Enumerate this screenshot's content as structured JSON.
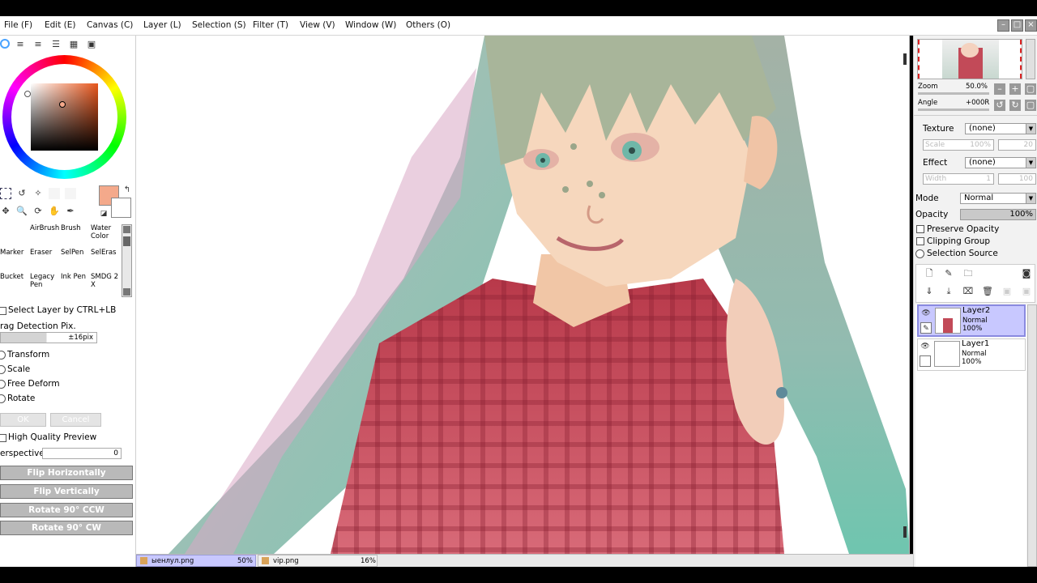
{
  "menu": [
    "File (F)",
    "Edit (E)",
    "Canvas (C)",
    "Layer (L)",
    "Selection (S)",
    "Filter (T)",
    "View (V)",
    "Window (W)",
    "Others (O)"
  ],
  "colors": {
    "primary": "#f4a98b",
    "secondary": "#ffffff",
    "accent": "#c8c8ff"
  },
  "tools": {
    "brushes": [
      [
        "",
        "AirBrush",
        "Brush",
        "Water Color"
      ],
      [
        "Marker",
        "Eraser",
        "SelPen",
        "SelEras"
      ],
      [
        "Bucket",
        "Legacy Pen",
        "Ink Pen",
        "SMDG 2 X"
      ]
    ]
  },
  "options": {
    "select_layer": "Select Layer by CTRL+LB",
    "drag_detection": "rag Detection Pix.",
    "drag_value": "±16pix",
    "transform": "Transform",
    "scale": "Scale",
    "free_deform": "Free Deform",
    "rotate": "Rotate",
    "ok": "OK",
    "cancel": "Cancel",
    "high_quality": "High Quality Preview",
    "perspective": "erspective",
    "perspective_value": "0",
    "flip_h": "Flip Horizontally",
    "flip_v": "Flip Vertically",
    "rot_ccw": "Rotate 90° CCW",
    "rot_cw": "Rotate 90° CW"
  },
  "navigator": {
    "zoom_label": "Zoom",
    "zoom_value": "50.0%",
    "angle_label": "Angle",
    "angle_value": "+000R"
  },
  "texture": {
    "label": "Texture",
    "value": "(none)",
    "scale_label": "Scale",
    "scale_value": "100%",
    "scale_num": "20"
  },
  "effect": {
    "label": "Effect",
    "value": "(none)",
    "width_label": "Width",
    "width_value": "1",
    "width_num": "100"
  },
  "mode": {
    "label": "Mode",
    "value": "Normal"
  },
  "opacity": {
    "label": "Opacity",
    "value": "100%"
  },
  "layer_opts": {
    "preserve": "Preserve Opacity",
    "clipping": "Clipping Group",
    "selection_source": "Selection Source"
  },
  "layers": [
    {
      "name": "Layer2",
      "mode": "Normal",
      "opacity": "100%"
    },
    {
      "name": "Layer1",
      "mode": "Normal",
      "opacity": "100%"
    }
  ],
  "tabs": [
    {
      "name": "ыенлул.png",
      "zoom": "50%"
    },
    {
      "name": "vip.png",
      "zoom": "16%"
    }
  ]
}
